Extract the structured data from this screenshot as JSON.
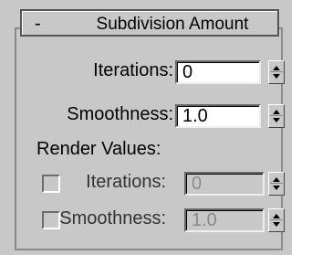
{
  "rollout": {
    "collapse_symbol": "-",
    "title": "Subdivision Amount"
  },
  "iterations": {
    "label": "Iterations:",
    "value": "0"
  },
  "smoothness": {
    "label": "Smoothness:",
    "value": "1.0"
  },
  "render_values": {
    "label": "Render Values:",
    "iterations": {
      "label": "Iterations:",
      "value": "0",
      "checked": false
    },
    "smoothness": {
      "label": "Smoothness:",
      "value": "1.0",
      "checked": false
    }
  }
}
